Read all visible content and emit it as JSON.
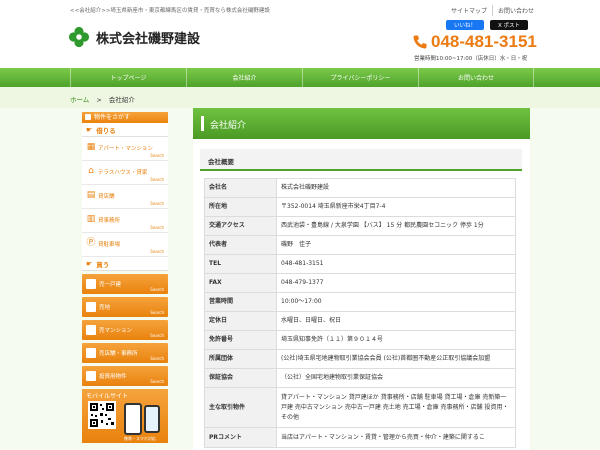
{
  "header": {
    "tagline": "<<会社紹介>>埼玉県新座市・東京都練馬区の賃貸・売買なら株式会社磯野建設",
    "top_links": [
      "サイトマップ",
      "お問い合わせ"
    ],
    "facebook_label": "いいね！",
    "x_label": "X ポスト",
    "logo_text": "株式会社磯野建設",
    "phone": "048-481-3151",
    "hours": "営業時間10:00~17:00（店休日）水・日・祝"
  },
  "nav": {
    "items": [
      "トップページ",
      "会社紹介",
      "プライバシーポリシー",
      "お問い合わせ"
    ]
  },
  "breadcrumb": {
    "home": "ホーム",
    "separator": ">",
    "current": "会社紹介"
  },
  "sidebar": {
    "search_header": "物件をさがす",
    "rent_header": "借りる",
    "rent_items": [
      "アパート・マンション",
      "テラスハウス・貸家",
      "貸店舗",
      "貸事務所",
      "貸駐車場"
    ],
    "buy_header": "買う",
    "buy_items": [
      "売一戸建",
      "売地",
      "売マンション",
      "売店舗・事務所",
      "投資用物件"
    ],
    "search_badge": "Search",
    "mobile_title": "モバイルサイト",
    "mobile_note": "携帯・スマホ対応"
  },
  "main": {
    "page_title": "会社紹介",
    "section_title": "会社概要",
    "table": [
      {
        "key": "会社名",
        "value": "株式会社磯野建設"
      },
      {
        "key": "所在地",
        "value": "〒352-0014 埼玉県新座市栄4丁目7-4"
      },
      {
        "key": "交通アクセス",
        "value": "西武池袋・豊島線 / 大泉学園 【バス】 15 分 都民農園セコニック 停歩 1分"
      },
      {
        "key": "代表者",
        "value": "磯野　佳子"
      },
      {
        "key": "TEL",
        "value": "048-481-3151"
      },
      {
        "key": "FAX",
        "value": "048-479-1377"
      },
      {
        "key": "営業時間",
        "value": "10:00～17:00"
      },
      {
        "key": "定休日",
        "value": "水曜日、日曜日、祝日"
      },
      {
        "key": "免許番号",
        "value": "埼玉県知事免許（１１）第９０１４号"
      },
      {
        "key": "所属団体",
        "value": "(公社)埼玉県宅地建物取引業協会会員 (公社)首都圏不動産公正取引協議会加盟"
      },
      {
        "key": "保証協会",
        "value": "（公社）全国宅地建物取引業保証協会"
      },
      {
        "key": "主な取引物件",
        "value": "貸アパート・マンション 貸戸建ほか 貸事務所・店舗 駐車場 貸工場・倉庫 売新築一戸建 売中古マンション 売中古一戸建 売土地 売工場・倉庫 売事務所・店舗 投資用・その他"
      },
      {
        "key": "PRコメント",
        "value": "当店はアパート・マンション・賃貸・管理から売買・仲介・建築に関するこ"
      }
    ]
  },
  "colors": {
    "nav_green": "#4ea22a",
    "accent_orange": "#ec7b13",
    "link_green": "#3a8e1a"
  }
}
